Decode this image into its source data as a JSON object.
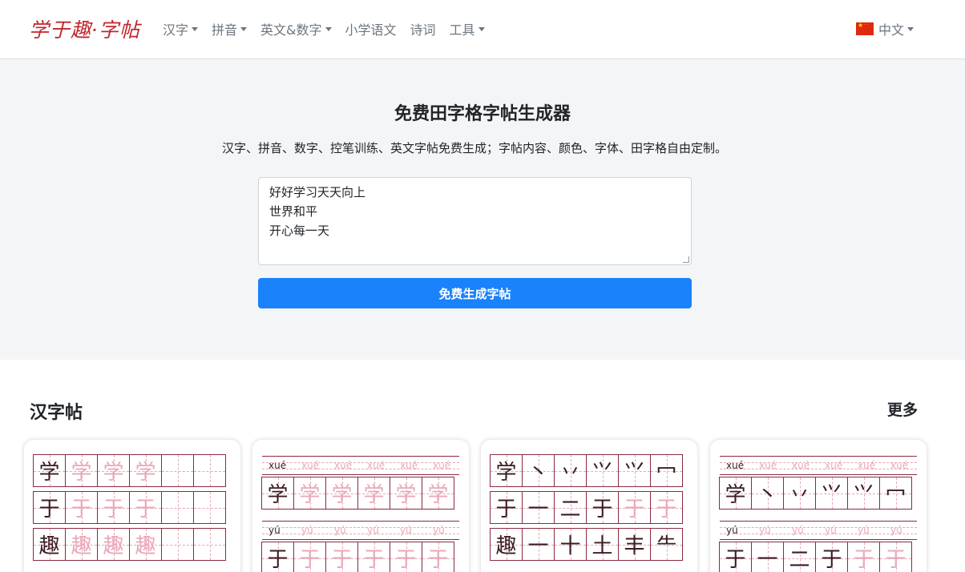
{
  "nav": {
    "logo": "学于趣·字帖",
    "items": [
      {
        "label": "汉字",
        "dropdown": true
      },
      {
        "label": "拼音",
        "dropdown": true
      },
      {
        "label": "英文&数字",
        "dropdown": true
      },
      {
        "label": "小学语文",
        "dropdown": false
      },
      {
        "label": "诗词",
        "dropdown": false
      },
      {
        "label": "工具",
        "dropdown": true
      }
    ],
    "language": "中文"
  },
  "hero": {
    "title": "免费田字格字帖生成器",
    "subtitle": "汉字、拼音、数字、控笔训练、英文字帖免费生成；字帖内容、颜色、字体、田字格自由定制。",
    "textarea_value": "好好学习天天向上\n世界和平\n开心每一天",
    "button_label": "免费生成字帖"
  },
  "section": {
    "title": "汉字帖",
    "more_label": "更多"
  },
  "cards": [
    {
      "type": "grid",
      "rows": [
        {
          "cells": [
            {
              "ch": "学",
              "trace": false
            },
            {
              "ch": "学",
              "trace": true
            },
            {
              "ch": "学",
              "trace": true
            },
            {
              "ch": "学",
              "trace": true
            },
            {
              "ch": "",
              "trace": true
            },
            {
              "ch": "",
              "trace": true
            }
          ]
        },
        {
          "cells": [
            {
              "ch": "于",
              "trace": false
            },
            {
              "ch": "于",
              "trace": true
            },
            {
              "ch": "于",
              "trace": true
            },
            {
              "ch": "于",
              "trace": true
            },
            {
              "ch": "",
              "trace": true
            },
            {
              "ch": "",
              "trace": true
            }
          ]
        },
        {
          "cells": [
            {
              "ch": "趣",
              "trace": false
            },
            {
              "ch": "趣",
              "trace": true
            },
            {
              "ch": "趣",
              "trace": true
            },
            {
              "ch": "趣",
              "trace": true
            },
            {
              "ch": "",
              "trace": true
            },
            {
              "ch": "",
              "trace": true
            }
          ]
        }
      ]
    },
    {
      "type": "pinyin",
      "rows": [
        {
          "pinyin": [
            "xué",
            "xué",
            "xué",
            "xué",
            "xué",
            "xué"
          ],
          "cells": [
            {
              "ch": "学",
              "trace": false
            },
            {
              "ch": "学",
              "trace": true
            },
            {
              "ch": "学",
              "trace": true
            },
            {
              "ch": "学",
              "trace": true
            },
            {
              "ch": "学",
              "trace": true
            },
            {
              "ch": "学",
              "trace": true
            }
          ]
        },
        {
          "pinyin": [
            "yú",
            "yú",
            "yú",
            "yú",
            "yú",
            "yú"
          ],
          "cells": [
            {
              "ch": "于",
              "trace": false
            },
            {
              "ch": "于",
              "trace": true
            },
            {
              "ch": "于",
              "trace": true
            },
            {
              "ch": "于",
              "trace": true
            },
            {
              "ch": "于",
              "trace": true
            },
            {
              "ch": "于",
              "trace": true
            }
          ]
        }
      ]
    },
    {
      "type": "grid",
      "rows": [
        {
          "cells": [
            {
              "ch": "学",
              "trace": false
            },
            {
              "ch": "丶",
              "trace": false
            },
            {
              "ch": "丷",
              "trace": false
            },
            {
              "ch": "⺍",
              "trace": false
            },
            {
              "ch": "⺍",
              "trace": false
            },
            {
              "ch": "冖",
              "trace": false
            }
          ]
        },
        {
          "cells": [
            {
              "ch": "于",
              "trace": false
            },
            {
              "ch": "一",
              "trace": false
            },
            {
              "ch": "二",
              "trace": false
            },
            {
              "ch": "于",
              "trace": false
            },
            {
              "ch": "于",
              "trace": true
            },
            {
              "ch": "于",
              "trace": true
            }
          ]
        },
        {
          "cells": [
            {
              "ch": "趣",
              "trace": false
            },
            {
              "ch": "一",
              "trace": false
            },
            {
              "ch": "十",
              "trace": false
            },
            {
              "ch": "土",
              "trace": false
            },
            {
              "ch": "丰",
              "trace": false
            },
            {
              "ch": "⺧",
              "trace": false
            }
          ]
        }
      ]
    },
    {
      "type": "pinyin",
      "rows": [
        {
          "pinyin": [
            "xué",
            "xué",
            "xué",
            "xué",
            "xué",
            "xué"
          ],
          "cells": [
            {
              "ch": "学",
              "trace": false
            },
            {
              "ch": "丶",
              "trace": false
            },
            {
              "ch": "丷",
              "trace": false
            },
            {
              "ch": "⺍",
              "trace": false
            },
            {
              "ch": "⺍",
              "trace": false
            },
            {
              "ch": "冖",
              "trace": false
            }
          ]
        },
        {
          "pinyin": [
            "yú",
            "yú",
            "yú",
            "yú",
            "yú",
            "yú"
          ],
          "cells": [
            {
              "ch": "于",
              "trace": false
            },
            {
              "ch": "一",
              "trace": false
            },
            {
              "ch": "二",
              "trace": false
            },
            {
              "ch": "于",
              "trace": false
            },
            {
              "ch": "于",
              "trace": true
            },
            {
              "ch": "于",
              "trace": true
            }
          ]
        }
      ]
    }
  ],
  "colors": {
    "brand": "#c0272d",
    "primary_button": "#1a82fb",
    "grid_line": "#8b2a3f",
    "trace_char": "#e9a9b8",
    "hero_bg": "#f4f5f7"
  }
}
